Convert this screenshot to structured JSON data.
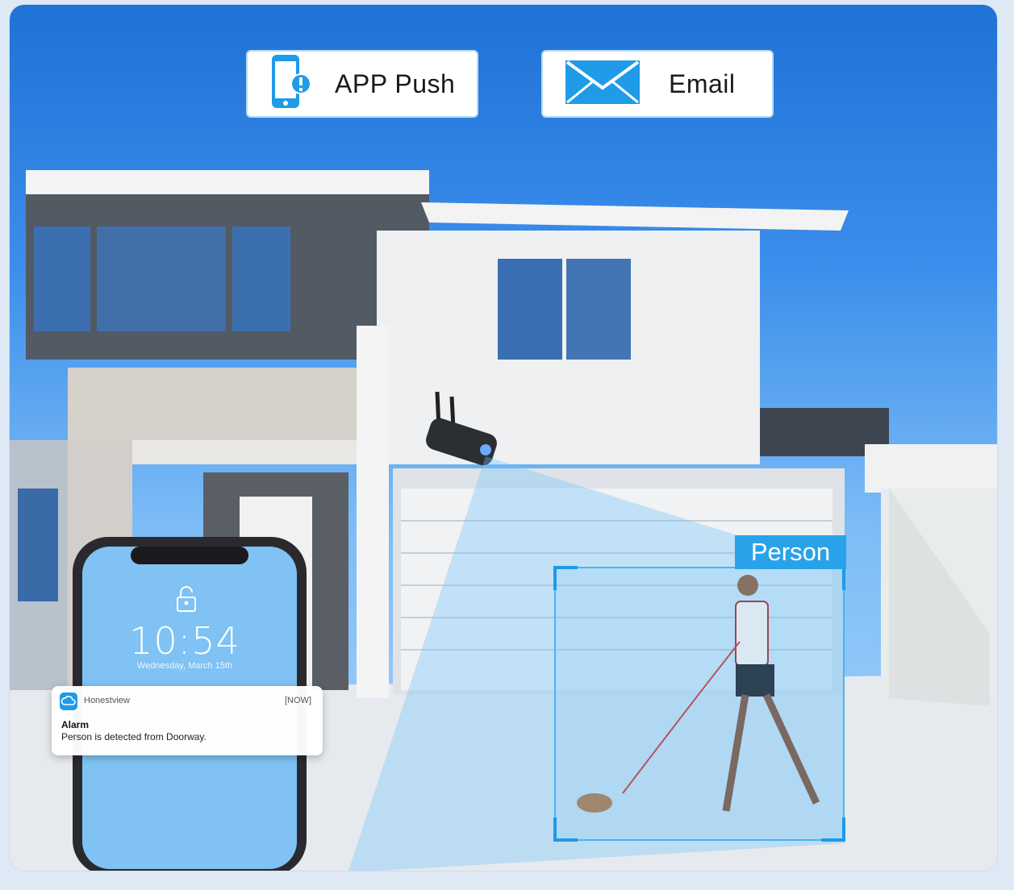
{
  "badges": {
    "app_push": "APP Push",
    "email": "Email"
  },
  "detection": {
    "label": "Person"
  },
  "phone": {
    "time": "10:54",
    "date": "Wednesday, March 15th",
    "notification": {
      "app_name": "Honestview",
      "timestamp": "[NOW]",
      "title": "Alarm",
      "message": "Person is detected from Doorway."
    }
  },
  "icons": [
    "phone-alert-icon",
    "envelope-icon",
    "lock-icon",
    "app-cloud-icon"
  ],
  "colors": {
    "accent": "#2aa2ea",
    "sky": "#1f72d6"
  }
}
